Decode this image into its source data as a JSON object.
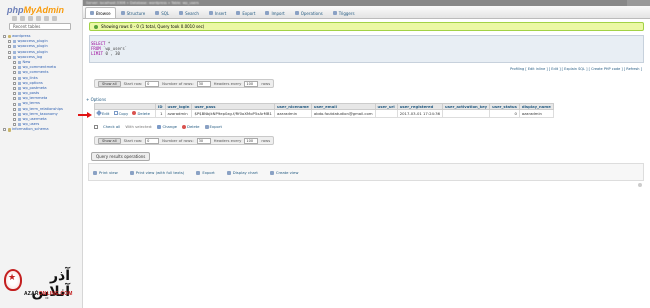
{
  "nav": {
    "logo_php": "php",
    "logo_admin": "MyAdmin",
    "recent_label": "Recent tables",
    "tree": [
      {
        "label": "wordpress",
        "kind": "db",
        "depth": 0
      },
      {
        "label": "wpaccess_plugin",
        "kind": "tbl",
        "depth": 1
      },
      {
        "label": "wpaccess_plugin",
        "kind": "tbl",
        "depth": 1
      },
      {
        "label": "wpaccess_plugin",
        "kind": "tbl",
        "depth": 1
      },
      {
        "label": "wpaccess_log",
        "kind": "tbl",
        "depth": 1
      },
      {
        "label": "New",
        "kind": "tbl",
        "depth": 2
      },
      {
        "label": "wp_commentmeta",
        "kind": "tbl",
        "depth": 2
      },
      {
        "label": "wp_comments",
        "kind": "tbl",
        "depth": 2
      },
      {
        "label": "wp_links",
        "kind": "tbl",
        "depth": 2
      },
      {
        "label": "wp_options",
        "kind": "tbl",
        "depth": 2
      },
      {
        "label": "wp_postmeta",
        "kind": "tbl",
        "depth": 2
      },
      {
        "label": "wp_posts",
        "kind": "tbl",
        "depth": 2
      },
      {
        "label": "wp_termmeta",
        "kind": "tbl",
        "depth": 2
      },
      {
        "label": "wp_terms",
        "kind": "tbl",
        "depth": 2
      },
      {
        "label": "wp_term_relationships",
        "kind": "tbl",
        "depth": 2
      },
      {
        "label": "wp_term_taxonomy",
        "kind": "tbl",
        "depth": 2
      },
      {
        "label": "wp_usermeta",
        "kind": "tbl",
        "depth": 2
      },
      {
        "label": "wp_users",
        "kind": "tbl",
        "depth": 2
      },
      {
        "label": "information_schema",
        "kind": "db",
        "depth": 0
      }
    ]
  },
  "header": {
    "breadcrumb": "Server: localhost:3306 » Database: wordpress » Table: wp_users",
    "tabs": [
      "Browse",
      "Structure",
      "SQL",
      "Search",
      "Insert",
      "Export",
      "Import",
      "Operations",
      "Triggers"
    ],
    "active_tab": "Browse"
  },
  "success_message": "Showing rows 0 - 0 (1 total, Query took 0.0010 sec)",
  "sql": {
    "line1_kw": "SELECT",
    "line1_id": "*",
    "line2_kw": "FROM",
    "line2_id": "`wp_users`",
    "line3_kw": "LIMIT",
    "line3_id": "0 , 30"
  },
  "profiling_links": "Profiling [ Edit inline ] [ Edit ] [ Explain SQL ] [ Create PHP code ] [ Refresh ]",
  "navbar": {
    "show_all": "Show all",
    "start_row_label": "Start row:",
    "start_row": "0",
    "rows_label": "Number of rows:",
    "rows": "30",
    "headers_label": "Headers every",
    "headers_every": "100",
    "rows_suffix": "rows"
  },
  "options_link": "+ Options",
  "table": {
    "columns": [
      "ID",
      "user_login",
      "user_pass",
      "user_nicename",
      "user_email",
      "user_url",
      "user_registered",
      "user_activation_key",
      "user_status",
      "display_name"
    ],
    "row": {
      "edit": "Edit",
      "copy": "Copy",
      "delete": "Delete",
      "ID": "1",
      "user_login": "azaradmin",
      "user_pass": "$P$BNbjkNP9ep0zg.f/Rf0oXMoP5xArMB1",
      "user_nicename": "azaradmin",
      "user_email": "abdo.foutdatudion@gmail.com",
      "user_url": "",
      "user_registered": "2017-03-01 17:24:36",
      "user_activation_key": "",
      "user_status": "0",
      "display_name": "azaradmin"
    }
  },
  "bulk": {
    "check_all": "Check all",
    "with_selected": "With selected:",
    "change": "Change",
    "delete": "Delete",
    "export": "Export"
  },
  "query_results_button": "Query results operations",
  "qro": {
    "print": "Print view",
    "print_full": "Print view (with full texts)",
    "export": "Export",
    "display_chart": "Display chart",
    "create_view": "Create view"
  },
  "watermark": {
    "fa": "آذر آنلاین",
    "en_prefix": "AZAR",
    "en_suffix": "ONLINE.COM"
  },
  "colors": {
    "logo_php": "#6c7eb7",
    "logo_admin": "#f89c0e",
    "success_bg": "#ebf8a4",
    "arrow": "#e01414",
    "link": "#235a81"
  }
}
